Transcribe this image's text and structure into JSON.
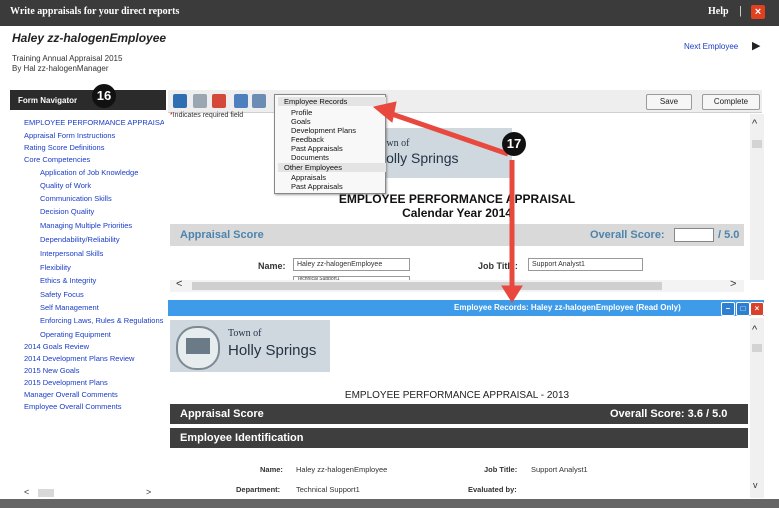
{
  "window": {
    "title": "Write appraisals for your direct reports",
    "help_label": "Help",
    "separator": "|",
    "close_glyph": "×"
  },
  "header": {
    "employee_name": "Haley zz-halogenEmployee",
    "appraisal_name": "Training Annual Appraisal 2015",
    "manager_line": "By Hal zz-halogenManager",
    "next_label": "Next Employee",
    "next_arrow": "▶"
  },
  "badges": {
    "b16": "16",
    "b17": "17"
  },
  "navigator": {
    "title": "Form Navigator",
    "items": [
      "EMPLOYEE PERFORMANCE APPRAISAL",
      "Appraisal Form Instructions",
      "Rating Score Definitions",
      "Core Competencies",
      "Application of Job Knowledge",
      "Quality of Work",
      "Communication Skills",
      "Decision Quality",
      "Managing Multiple Priorities",
      "Dependability/Reliability",
      "Interpersonal Skills",
      "Flexibility",
      "Ethics & Integrity",
      "Safety Focus",
      "Self Management",
      "Enforcing Laws, Rules & Regulations",
      "Operating Equipment",
      "2014 Goals Review",
      "2014 Development Plans Review",
      "2015 New Goals",
      "2015 Development Plans",
      "Manager Overall Comments",
      "Employee Overall Comments"
    ],
    "scroll_left": "<",
    "scroll_right": ">"
  },
  "toolbar": {
    "save_label": "Save",
    "complete_label": "Complete",
    "icons": [
      "form-icon",
      "print-icon",
      "pdf-icon",
      "spellcheck-icon",
      "records-icon"
    ]
  },
  "required_note": {
    "star": "*",
    "text": "Indicates required field"
  },
  "records_menu": {
    "header1": "Employee Records",
    "items1": [
      "Profile",
      "Goals",
      "Development Plans",
      "Feedback",
      "Past Appraisals",
      "Documents"
    ],
    "header2": "Other Employees",
    "items2": [
      "Appraisals",
      "Past Appraisals"
    ]
  },
  "form_top": {
    "logo_town": "Town of",
    "logo_name": "Holly Springs",
    "title": "EMPLOYEE PERFORMANCE APPRAISAL",
    "subtitle": "Calendar Year 2014",
    "score_section": "Appraisal Score",
    "overall_label": "Overall Score:",
    "overall_max": "/ 5.0",
    "name_label": "Name:",
    "name_value": "Haley zz-halogenEmployee",
    "jobtitle_label": "Job Title:",
    "jobtitle_value": "Support Analyst1",
    "dept_value": "Technical Support1",
    "scroll_left": "<",
    "scroll_right": ">",
    "scroll_up": "^"
  },
  "records_window": {
    "title": "Employee Records: Haley zz-halogenEmployee (Read Only)",
    "logo_town": "Town of",
    "logo_name": "Holly Springs",
    "title_text": "EMPLOYEE PERFORMANCE APPRAISAL - 2013",
    "score_section": "Appraisal Score",
    "overall_score": "Overall Score: 3.6 / 5.0",
    "ident_section": "Employee Identification",
    "name_label": "Name:",
    "name_value": "Haley zz-halogenEmployee",
    "jobtitle_label": "Job Title:",
    "jobtitle_value": "Support Analyst1",
    "dept_label": "Department:",
    "dept_value": "Technical Support1",
    "evaluated_label": "Evaluated by:",
    "scroll_up": "^",
    "scroll_down": "v"
  },
  "colors": {
    "accent_blue": "#3e9be9",
    "arrow_red": "#e8483e",
    "link_blue": "#1a3cc6",
    "title_bar": "#3b3b3b",
    "section_blue": "#4d84ad"
  }
}
